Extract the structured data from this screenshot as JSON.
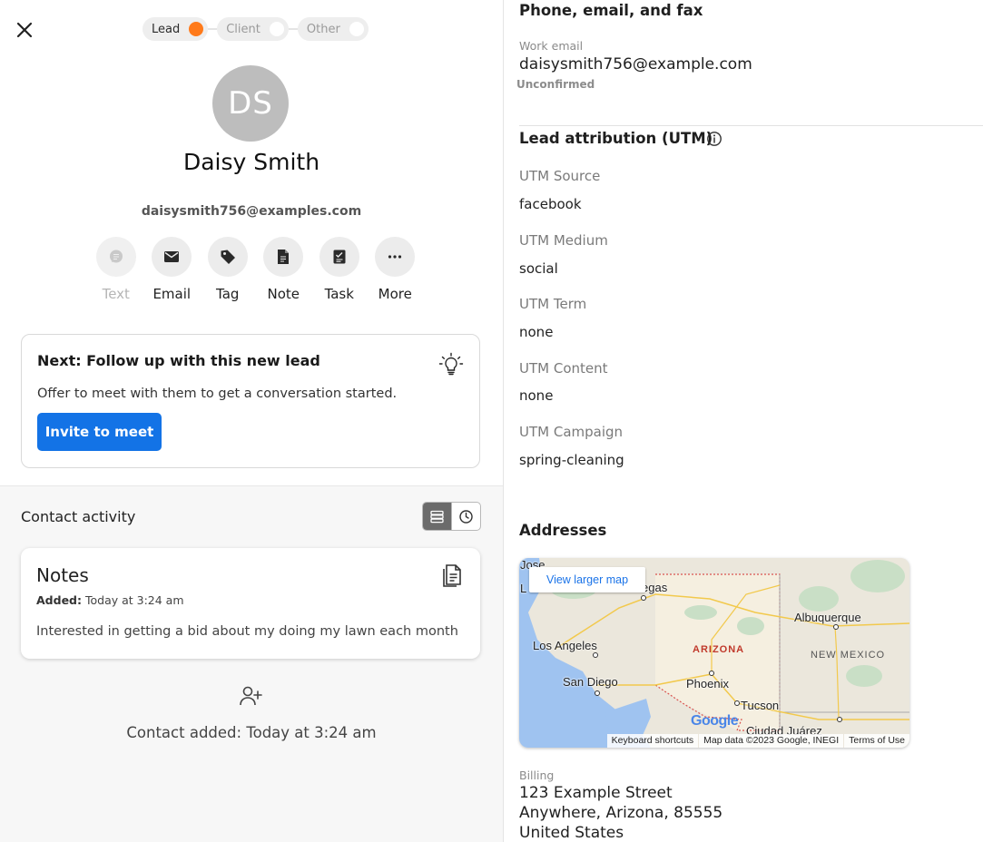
{
  "stages": [
    {
      "label": "Lead",
      "active": true
    },
    {
      "label": "Client",
      "active": false
    },
    {
      "label": "Other",
      "active": false
    }
  ],
  "contact": {
    "initials": "DS",
    "name": "Daisy Smith",
    "email": "daisysmith756@examples.com"
  },
  "actions": [
    {
      "label": "Text",
      "icon": "chat-icon",
      "disabled": true
    },
    {
      "label": "Email",
      "icon": "envelope-icon",
      "disabled": false
    },
    {
      "label": "Tag",
      "icon": "tag-icon",
      "disabled": false
    },
    {
      "label": "Note",
      "icon": "note-icon",
      "disabled": false
    },
    {
      "label": "Task",
      "icon": "task-icon",
      "disabled": false
    },
    {
      "label": "More",
      "icon": "more-icon",
      "disabled": false
    }
  ],
  "next_step": {
    "title": "Next: Follow up with this new lead",
    "description": "Offer to meet with them to get a conversation started.",
    "button": "Invite to meet"
  },
  "activity": {
    "title": "Contact activity",
    "note": {
      "title": "Notes",
      "added_label": "Added:",
      "added_value": "Today at 3:24 am",
      "body": "Interested in getting a bid about my doing my lawn each month"
    },
    "contact_added": "Contact added: Today at 3:24 am"
  },
  "details": {
    "phone_section": "Phone, email, and fax",
    "work_email_label": "Work email",
    "work_email": "daisysmith756@example.com",
    "unconfirmed": "Unconfirmed",
    "utm_section": "Lead attribution (UTM)",
    "utm": [
      {
        "label": "UTM Source",
        "value": "facebook"
      },
      {
        "label": "UTM Medium",
        "value": "social"
      },
      {
        "label": "UTM Term",
        "value": "none"
      },
      {
        "label": "UTM Content",
        "value": "none"
      },
      {
        "label": "UTM Campaign",
        "value": "spring-cleaning"
      }
    ],
    "addresses_section": "Addresses",
    "billing_label": "Billing",
    "billing_lines": [
      "123 Example Street",
      "Anywhere, Arizona, 85555",
      "United States"
    ]
  },
  "map": {
    "view_larger": "View larger map",
    "places": [
      "Jose",
      "L",
      "egas",
      "Albuquerque",
      "Los Angeles",
      "ARIZONA",
      "NEW MEXICO",
      "San Diego",
      "Phoenix",
      "Tucson",
      "Ciudad Juárez"
    ],
    "footer": [
      "Keyboard shortcuts",
      "Map data ©2023 Google, INEGI",
      "Terms of Use"
    ],
    "logo": "Google"
  },
  "colors": {
    "accent": "#1373e6",
    "lead_dot": "#ff7a1a",
    "avatar": "#bdbdbd"
  }
}
